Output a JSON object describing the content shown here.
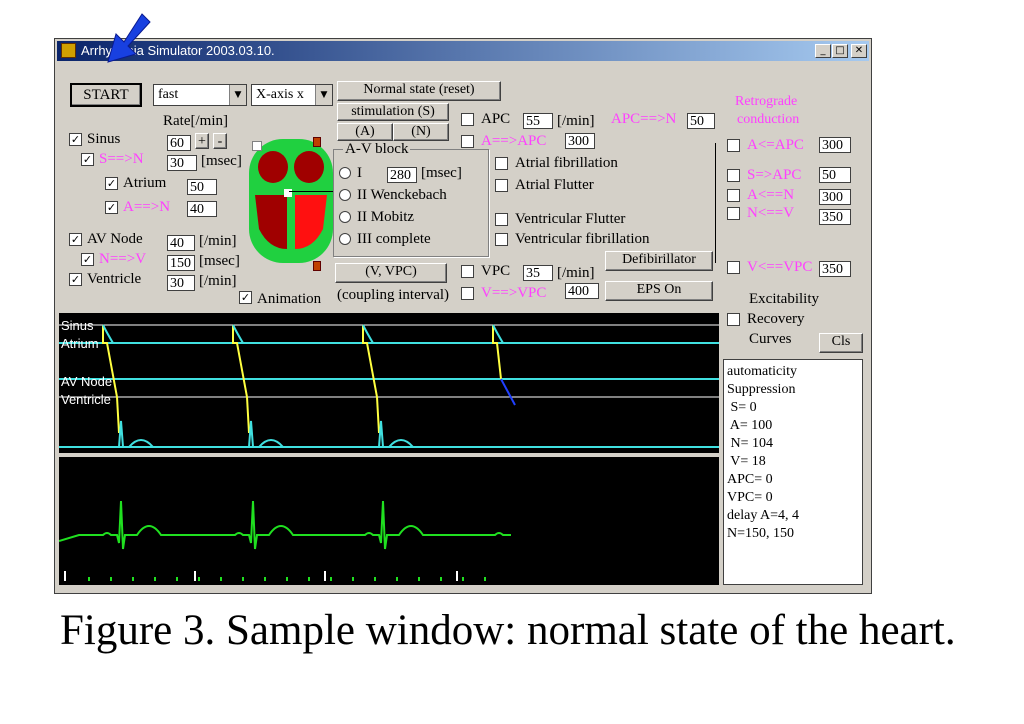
{
  "window": {
    "title": "Arrhythmia Simulator 2003.03.10.",
    "min_label": "_",
    "max_label": "□",
    "close_label": "✕"
  },
  "toolbar": {
    "start_label": "START",
    "speed_value": "fast",
    "axis_value": "X-axis x",
    "normal_label": "Normal state (reset)",
    "stim_label": "stimulation (S)",
    "a_label": "(A)",
    "n_label": "(N)"
  },
  "left": {
    "rate_label": "Rate[/min]",
    "sinus_label": "Sinus",
    "sinus_checked": true,
    "rate_value": "60",
    "plus_label": "+",
    "minus_label": "-",
    "s_to_n_label": "S==>N",
    "s_to_n_checked": true,
    "s_to_n_value": "30",
    "msec_label": "[msec]",
    "atrium_label": "Atrium",
    "atrium_checked": true,
    "atrium_value": "50",
    "a_to_n_label": "A==>N",
    "a_to_n_checked": true,
    "a_to_n_value": "40",
    "avnode_label": "AV Node",
    "avnode_checked": true,
    "avnode_value": "40",
    "permin_label": "[/min]",
    "n_to_v_label": "N==>V",
    "n_to_v_checked": true,
    "n_to_v_value": "150",
    "msec2_label": "[msec]",
    "ventricle_label": "Ventricle",
    "ventricle_checked": true,
    "ventricle_value": "30",
    "permin2_label": "[/min]",
    "animation_label": "Animation",
    "animation_checked": true
  },
  "avblock": {
    "title": "A-V block",
    "opt1_label": "I",
    "opt1_value": "280",
    "opt1_unit": "[msec]",
    "opt2_label": "II Wenckebach",
    "opt3_label": "II Mobitz",
    "opt4_label": "III complete"
  },
  "vvpc": {
    "button_label": "(V, VPC)",
    "coupling_label": "(coupling interval)"
  },
  "middle": {
    "apc_label": "APC",
    "apc_value": "55",
    "apc_unit": "[/min]",
    "apc_to_n_label": "APC==>N",
    "apc_to_n_value": "50",
    "a_to_apc_label": "A==>APC",
    "a_to_apc_value": "300",
    "afib_label": "Atrial fibrillation",
    "aflutter_label": "Atrial Flutter",
    "vflutter_label": "Ventricular Flutter",
    "vfib_label": "Ventricular fibrillation",
    "vpc_label": "VPC",
    "vpc_value": "35",
    "vpc_unit": "[/min]",
    "v_to_vpc_label": "V==>VPC",
    "v_to_vpc_value": "400",
    "defib_label": "Defibirillator",
    "eps_label": "EPS On"
  },
  "right": {
    "retro_line1": "Retrograde",
    "retro_line2": "conduction",
    "a_apc_label": "A<=APC",
    "a_apc_value": "300",
    "s_apc_label": "S=>APC",
    "s_apc_value": "50",
    "a_n_label": "A<==N",
    "a_n_value": "300",
    "n_v_label": "N<==V",
    "n_v_value": "350",
    "v_vpc_label": "V<==VPC",
    "v_vpc_value": "350",
    "excit_label": "Excitability",
    "recovery_label": "Recovery",
    "curves_label": "Curves",
    "cls_label": "Cls"
  },
  "ladder_labels": {
    "sinus": "Sinus",
    "atrium": "Atrium",
    "avnode": "AV Node",
    "ventricle": "Ventricle"
  },
  "log": {
    "l1": "automaticity",
    "l2": "Suppression",
    "l3": " S= 0",
    "l4": " A= 100",
    "l5": " N= 104",
    "l6": " V= 18",
    "l7": "APC= 0",
    "l8": "VPC= 0",
    "l9": "delay A=4, 4",
    "l10": "N=150, 150"
  },
  "caption": "Figure 3. Sample window: normal state of the heart.",
  "colors": {
    "magenta": "#ff40ff",
    "cyan": "#40e0e0",
    "yellow": "#ffff40",
    "green": "#20e020",
    "heart_red": "#ff1010",
    "heart_dark": "#a00000",
    "heart_green": "#20d040"
  }
}
